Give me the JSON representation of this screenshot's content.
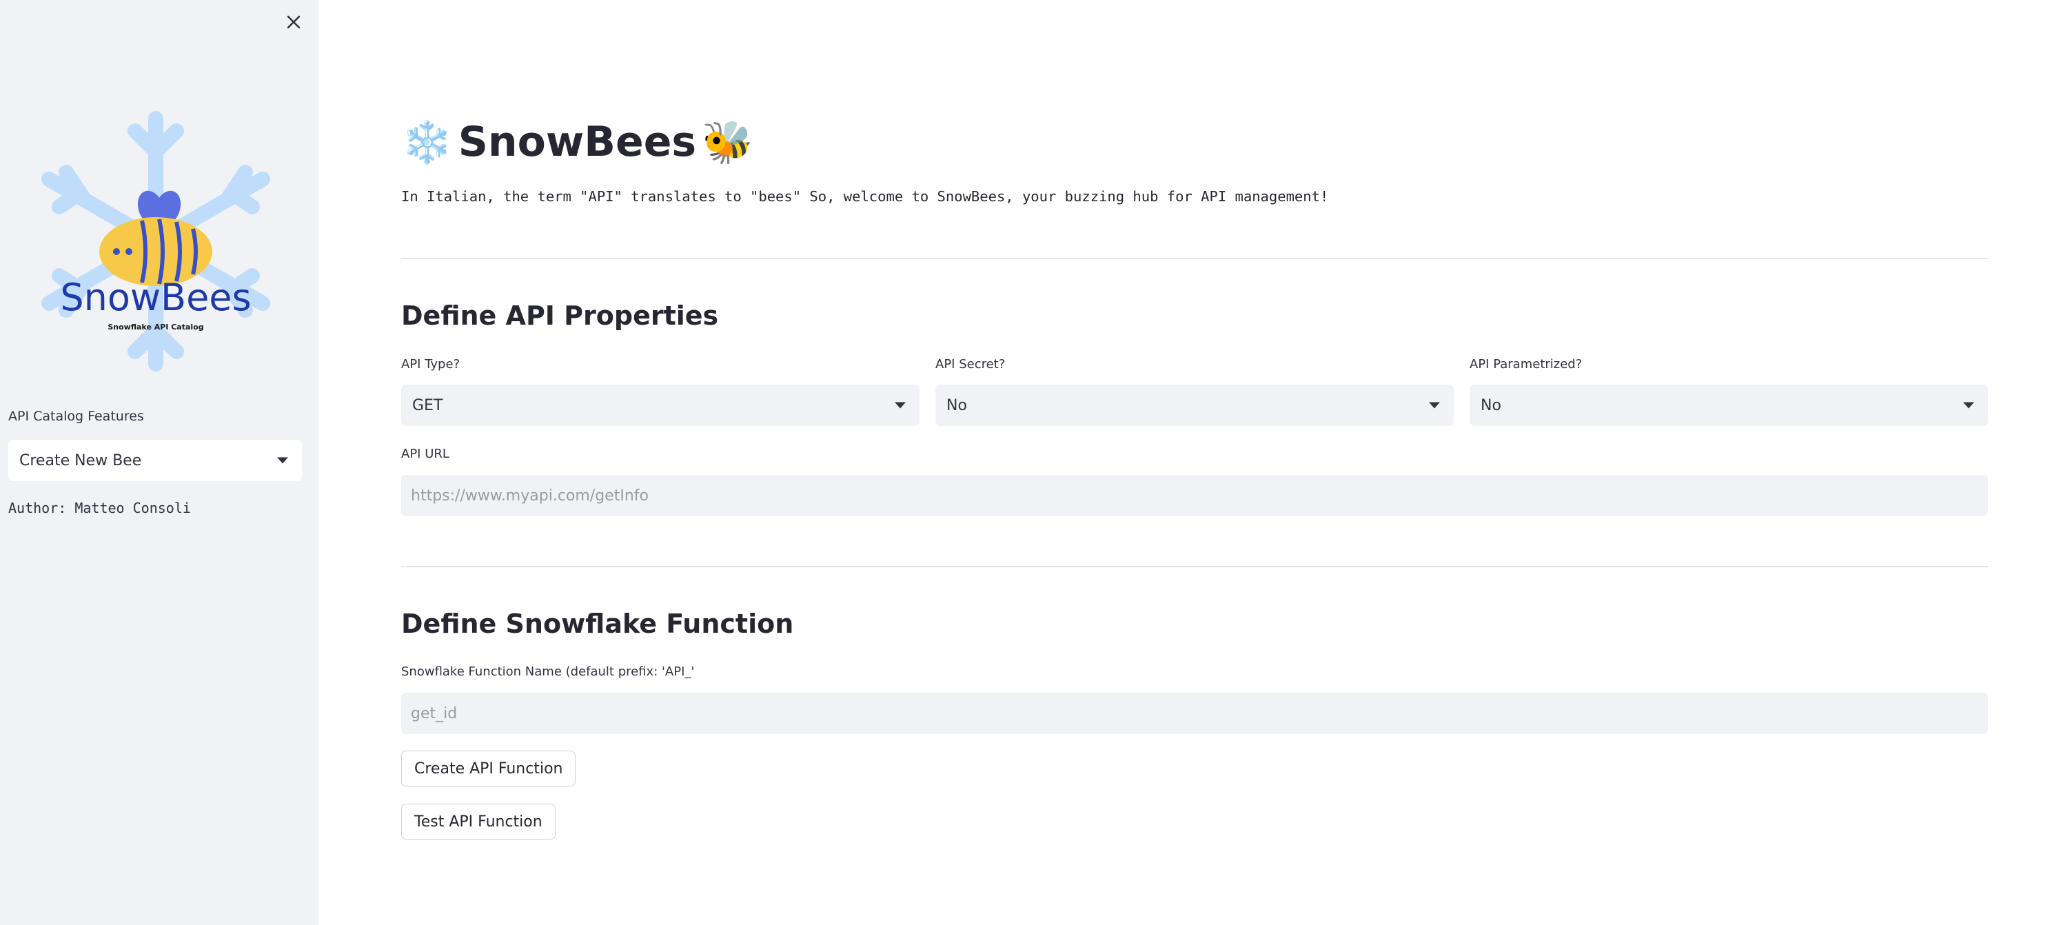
{
  "sidebar": {
    "logo_text": "SnowBees",
    "logo_subtitle": "Snowflake API Catalog",
    "features_label": "API Catalog Features",
    "features_selected": "Create New Bee",
    "author": "Author: Matteo Consoli"
  },
  "header": {
    "title": "SnowBees",
    "left_emoji": "❄️",
    "right_emoji": "🐝",
    "intro": "In Italian, the term \"API\" translates to \"bees\" So, welcome to SnowBees, your buzzing hub for API management!"
  },
  "api_section": {
    "heading": "Define API Properties",
    "api_type_label": "API Type?",
    "api_type_value": "GET",
    "api_secret_label": "API Secret?",
    "api_secret_value": "No",
    "api_parametrized_label": "API Parametrized?",
    "api_parametrized_value": "No",
    "api_url_label": "API URL",
    "api_url_placeholder": "https://www.myapi.com/getInfo"
  },
  "function_section": {
    "heading": "Define Snowflake Function",
    "name_label": "Snowflake Function Name (default prefix: 'API_'",
    "name_placeholder": "get_id",
    "create_button": "Create API Function",
    "test_button": "Test API Function"
  },
  "colors": {
    "sidebar_bg": "#f0f2f6",
    "logo_snowflake": "#bfdcfb",
    "logo_bee_body": "#f7c948",
    "logo_text": "#1e3aa8"
  }
}
